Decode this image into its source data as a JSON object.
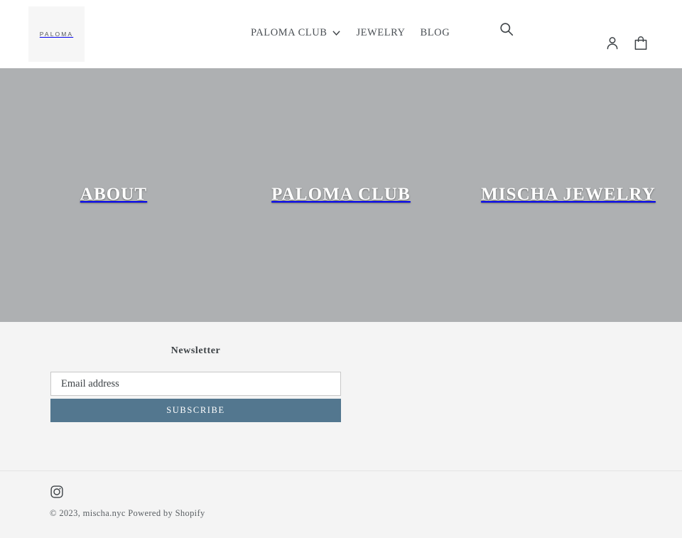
{
  "colors": {
    "header_bg": "#ffffff",
    "hero_bg": "#aeb0b2",
    "newsletter_bg": "#f4f4f4",
    "accent_button": "#53778f",
    "text": "#3d4246",
    "logo_tile": "#f6f6f6"
  },
  "header": {
    "logo_text": "PALOMA",
    "nav": [
      {
        "label": "PALOMA CLUB",
        "has_dropdown": true,
        "icon": "chevron-down-icon"
      },
      {
        "label": "JEWELRY",
        "has_dropdown": false
      },
      {
        "label": "BLOG",
        "has_dropdown": false
      }
    ],
    "search_icon": "search-icon",
    "account_icon": "account-icon",
    "cart_icon": "shopping-bag-icon"
  },
  "hero": {
    "cells": [
      {
        "title": "ABOUT"
      },
      {
        "title": "PALOMA CLUB"
      },
      {
        "title": "MISCHA JEWELRY"
      }
    ]
  },
  "newsletter": {
    "heading": "Newsletter",
    "email_value": "",
    "email_placeholder": "Email address",
    "submit_label": "SUBSCRIBE"
  },
  "footer": {
    "social_icon": "instagram-icon",
    "copyright": "© 2023, mischa.nyc Powered by Shopify",
    "copyright_parts": {
      "year": "© 2023,",
      "shop": "mischa.nyc",
      "powered": "Powered by Shopify"
    }
  }
}
